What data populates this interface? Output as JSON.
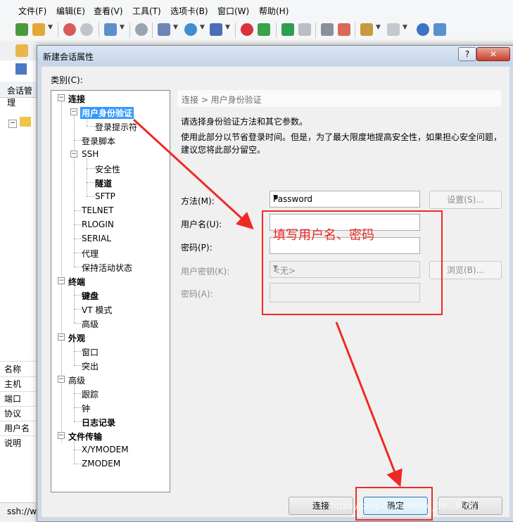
{
  "menu": [
    "文件(F)",
    "编辑(E)",
    "查看(V)",
    "工具(T)",
    "选项卡(B)",
    "窗口(W)",
    "帮助(H)"
  ],
  "background": {
    "session_manager_title": "会话管理",
    "property_labels": [
      "名称",
      "主机",
      "端口",
      "协议",
      "用户名",
      "说明"
    ],
    "status_text": "ssh://w"
  },
  "dialog": {
    "title": "新建会话属性",
    "help": "?",
    "close": "✕",
    "category_label": "类别(C):",
    "breadcrumb": "连接 > 用户身份验证",
    "desc1": "请选择身份验证方法和其它参数。",
    "desc2": "使用此部分以节省登录时间。但是，为了最大限度地提高安全性，如果担心安全问题，",
    "desc3": "建议您将此部分留空。",
    "method_label": "方法(M):",
    "method_value": "Password",
    "settings_button": "设置(S)...",
    "username_label": "用户名(U):",
    "username_value": "",
    "password_label": "密码(P):",
    "password_value": "",
    "userkey_label": "用户密钥(K):",
    "userkey_value": "<无>",
    "browse_button": "浏览(B)...",
    "passphrase_label": "密码(A):",
    "connect_button": "连接",
    "ok_button": "确定",
    "cancel_button": "取消"
  },
  "tree": {
    "connection": "连接",
    "user_auth": "用户身份验证",
    "login_prompts": "登录提示符",
    "login_script": "登录脚本",
    "ssh": "SSH",
    "security": "安全性",
    "tunneling": "隧道",
    "sftp": "SFTP",
    "telnet": "TELNET",
    "rlogin": "RLOGIN",
    "serial": "SERIAL",
    "proxy": "代理",
    "keepalive": "保持活动状态",
    "terminal": "终端",
    "keyboard": "键盘",
    "vt_modes": "VT 模式",
    "term_advanced": "高级",
    "appearance": "外观",
    "window": "窗口",
    "highlight": "突出",
    "advanced": "高级",
    "trace": "跟踪",
    "bell": "钟",
    "logging": "日志记录",
    "file_transfer": "文件传输",
    "xymodem": "X/YMODEM",
    "zmodem": "ZMODEM"
  },
  "annotation": {
    "text": "填写用户名、密码",
    "color": "#ee2a24"
  },
  "watermark": "https://blog.csdn.net/qq_39...9680",
  "colors": {
    "selection": "#3399ff",
    "annotation": "#ee2a24"
  }
}
